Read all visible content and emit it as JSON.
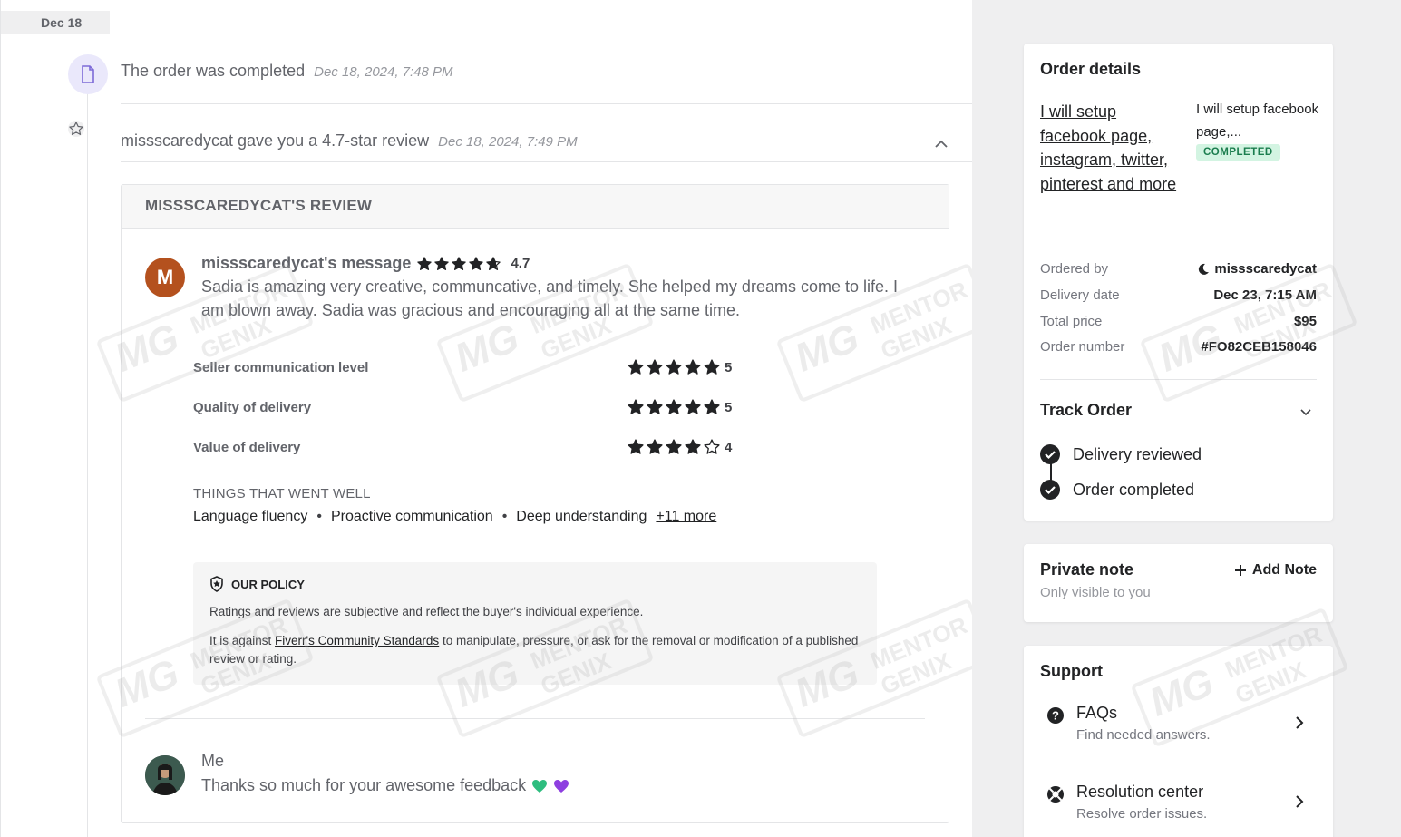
{
  "timeline": {
    "date_chip": "Dec 18",
    "event1": {
      "title": "The order was completed",
      "time": "Dec 18, 2024, 7:48 PM"
    },
    "event2": {
      "title": "missscaredycat gave you a 4.7-star review",
      "time": "Dec 18, 2024, 7:49 PM"
    }
  },
  "review": {
    "header": "MISSSCAREDYCAT'S REVIEW",
    "avatar_initial": "M",
    "avatar_color": "#b4511e",
    "message_title": "missscaredycat's message",
    "overall_rating": "4.7",
    "overall_rating_value": 4.7,
    "message_text": "Sadia is amazing very creative, communcative, and timely. She helped my dreams come to life. I am blown away. Sadia was gracious and encouraging all at the same time.",
    "criteria": [
      {
        "label": "Seller communication level",
        "score": "5",
        "value": 5
      },
      {
        "label": "Quality of delivery",
        "score": "5",
        "value": 5
      },
      {
        "label": "Value of delivery",
        "score": "4",
        "value": 4
      }
    ],
    "went_well_title": "THINGS THAT WENT WELL",
    "went_well": [
      "Language fluency",
      "Proactive communication",
      "Deep understanding"
    ],
    "more_link": "+11 more",
    "policy": {
      "title": "OUR POLICY",
      "line1": "Ratings and reviews are subjective and reflect the buyer's individual experience.",
      "line2_pre": "It is against ",
      "line2_link": "Fiverr's Community Standards",
      "line2_post": " to manipulate, pressure, or ask for the removal or modification of a published review or rating."
    },
    "reply": {
      "name": "Me",
      "text": "Thanks so much for your awesome feedback"
    }
  },
  "order_details": {
    "title": "Order details",
    "gig_image_alt": "I will setup facebook page, instagram, twitter, pinterest and more",
    "gig_title": "I will setup facebook page,...",
    "status_badge": "COMPLETED",
    "rows": [
      {
        "key": "Ordered by",
        "value": "missscaredycat"
      },
      {
        "key": "Delivery date",
        "value": "Dec 23, 7:15 AM"
      },
      {
        "key": "Total price",
        "value": "$95"
      },
      {
        "key": "Order number",
        "value": "#FO82CEB158046"
      }
    ],
    "track_title": "Track Order",
    "steps": [
      "Delivery reviewed",
      "Order completed"
    ]
  },
  "private_note": {
    "title": "Private note",
    "subtitle": "Only visible to you",
    "add_label": "Add Note"
  },
  "support": {
    "title": "Support",
    "items": [
      {
        "title": "FAQs",
        "subtitle": "Find needed answers."
      },
      {
        "title": "Resolution center",
        "subtitle": "Resolve order issues."
      }
    ]
  },
  "watermark_text": "MENTOR GENIX",
  "colors": {
    "success_bg": "#d3f4e2",
    "success_text": "#1b7d4e",
    "sidebar_bg": "#efeff0",
    "heart_green": "#2ebd7f",
    "heart_purple": "#8e3fe0"
  }
}
